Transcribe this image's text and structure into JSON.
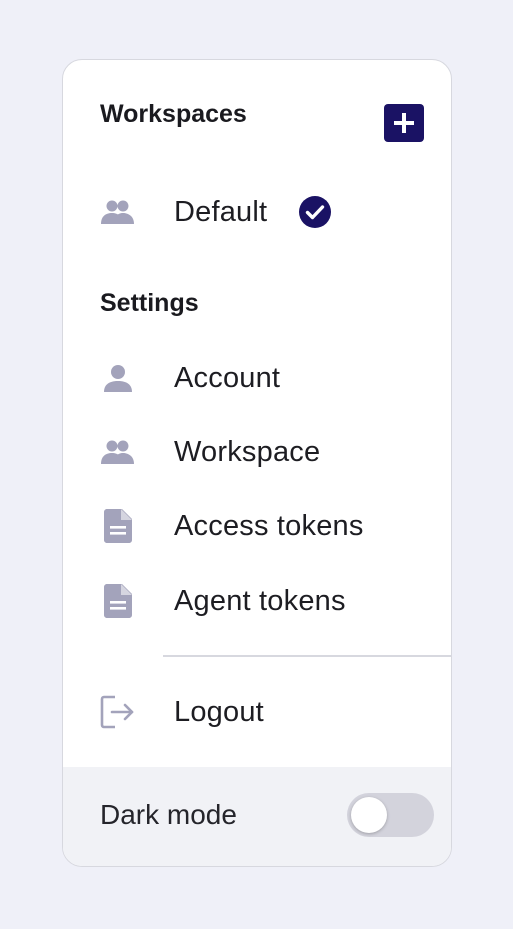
{
  "colors": {
    "background": "#eff0f8",
    "accent": "#1a1264",
    "icon": "#a3a3bb"
  },
  "workspaces": {
    "title": "Workspaces",
    "add_icon": "plus-icon",
    "items": [
      {
        "label": "Default",
        "icon": "group-icon",
        "selected": true,
        "selected_icon": "check-circle-icon"
      }
    ]
  },
  "settings": {
    "title": "Settings",
    "items": [
      {
        "label": "Account",
        "icon": "person-icon"
      },
      {
        "label": "Workspace",
        "icon": "group-icon"
      },
      {
        "label": "Access tokens",
        "icon": "document-icon"
      },
      {
        "label": "Agent tokens",
        "icon": "document-icon"
      }
    ]
  },
  "logout": {
    "label": "Logout",
    "icon": "logout-icon"
  },
  "footer": {
    "dark_mode_label": "Dark mode",
    "dark_mode_enabled": false
  }
}
